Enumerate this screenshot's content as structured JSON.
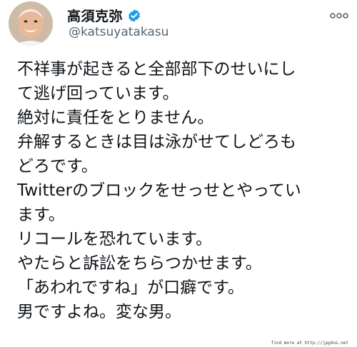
{
  "profile": {
    "display_name": "高須克弥",
    "handle": "@katsuyatakasu",
    "verified_icon": "verified-badge-icon",
    "badge_color": "#1d9bf0"
  },
  "tweet": {
    "lines": [
      "不祥事が起きると全部部下のせいにし",
      "て逃げ回っています。",
      "絶対に責任をとりません。",
      "弁解するときは目は泳がせてしどろも",
      "どろです。",
      "Twitterのブロックをせっせとやってい",
      "ます。",
      "リコールを恐れています。",
      "やたらと訴訟をちらつかせます。",
      "「あわれですね」が口癖です。",
      "男ですよね。変な男。"
    ]
  },
  "menu": {
    "icon": "more-options-icon"
  },
  "watermark": {
    "text": "find more at http://jpg4us.net"
  }
}
